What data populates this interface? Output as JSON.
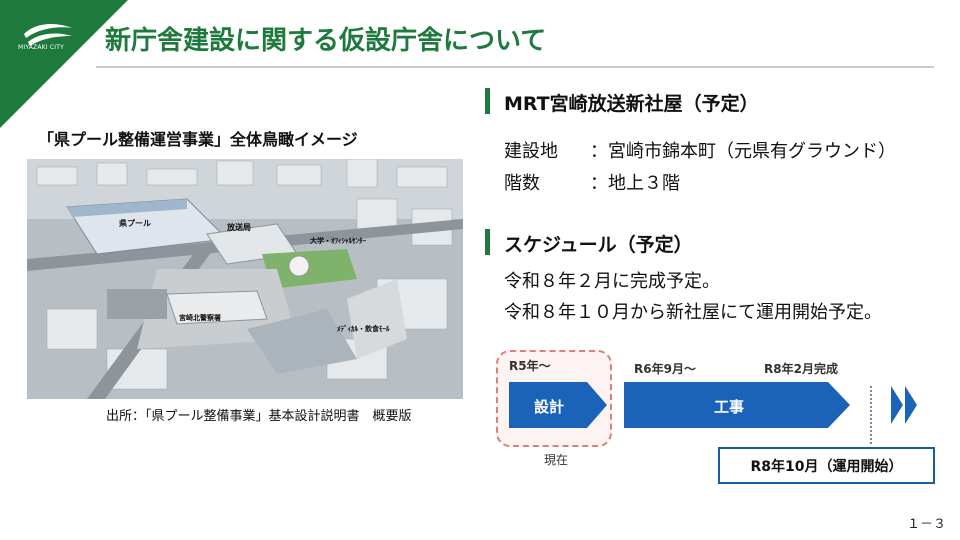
{
  "header": {
    "logo_text": "MIYAZAKI CITY",
    "title": "新庁舎建設に関する仮設庁舎について"
  },
  "image_panel": {
    "caption": "「県プール整備運営事業」全体鳥瞰イメージ",
    "labels": {
      "pool": "県プール",
      "broadcast": "放送局",
      "university": "大学・ｵﾌｨｼｬﾙｾﾝﾀｰ",
      "police": "宮崎北警察署",
      "media": "ﾒﾃﾞｨｶﾙ・飲食ﾓｰﾙ"
    },
    "source": "出所：「県プール整備事業」基本設計説明書　概要版"
  },
  "building": {
    "heading": "MRT宮崎放送新社屋（予定）",
    "rows": [
      {
        "label": "建設地",
        "value": "：宮崎市錦本町（元県有グラウンド）"
      },
      {
        "label": "階数",
        "value": "：地上３階"
      }
    ]
  },
  "schedule": {
    "heading": "スケジュール（予定）",
    "lines": [
      "令和８年２月に完成予定。",
      "令和８年１０月から新社屋にて運用開始予定。"
    ]
  },
  "timeline": {
    "design_start": "R5年～",
    "construction_start": "R6年9月～",
    "completion": "R8年2月完成",
    "design_label": "設計",
    "construction_label": "工事",
    "current_label": "現在",
    "operation_label": "R8年10月（運用開始）",
    "colors": {
      "arrow": "#1b63b8",
      "current_border": "#d9807a"
    }
  },
  "page_number": "１－３"
}
